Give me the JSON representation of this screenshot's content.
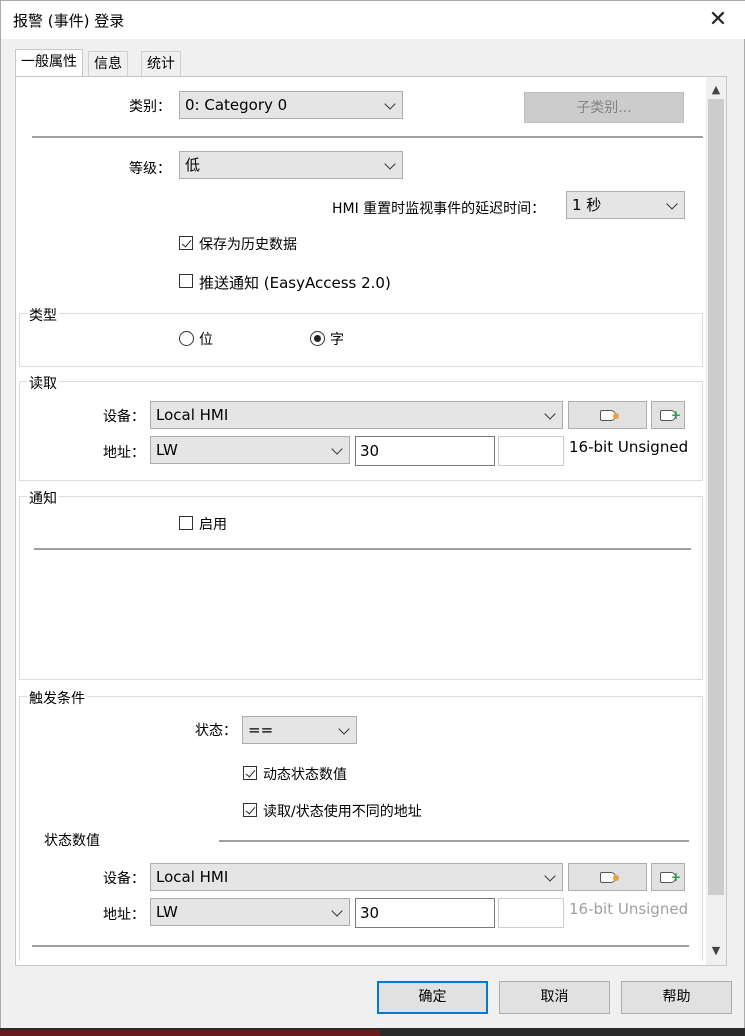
{
  "window": {
    "title": "报警 (事件) 登录",
    "close_glyph": "✕"
  },
  "tabs": [
    {
      "label": "一般属性"
    },
    {
      "label": "信息"
    },
    {
      "label": "统计"
    }
  ],
  "general": {
    "category_label": "类别：",
    "category_value": "0: Category 0",
    "subcategory_button": "子类别...",
    "level_label": "等级：",
    "level_value": "低",
    "delay_label": "HMI 重置时监视事件的延迟时间：",
    "delay_value": "1 秒",
    "save_history_label": "保存为历史数据",
    "save_history_checked": true,
    "push_label": "推送通知 (EasyAccess 2.0)",
    "push_checked": false
  },
  "type_group": {
    "title": "类型",
    "bit_label": "位",
    "word_label": "字",
    "selected": "word"
  },
  "read_group": {
    "title": "读取",
    "device_label": "设备：",
    "device_value": "Local HMI",
    "address_label": "地址：",
    "address_type": "LW",
    "address_value": "30",
    "address_extra": "",
    "data_type": "16-bit Unsigned"
  },
  "notify_group": {
    "title": "通知",
    "enable_label": "启用",
    "enable_checked": false
  },
  "trigger_group": {
    "title": "触发条件",
    "state_label": "状态：",
    "state_value": "==",
    "dynamic_label": "动态状态数值",
    "dynamic_checked": true,
    "diff_addr_label": "读取/状态使用不同的地址",
    "diff_addr_checked": true,
    "state_value_title": "状态数值",
    "device_label": "设备：",
    "device_value": "Local HMI",
    "address_label": "地址：",
    "address_type": "LW",
    "address_value": "30",
    "address_extra": "",
    "data_type": "16-bit Unsigned"
  },
  "footer": {
    "ok": "确定",
    "cancel": "取消",
    "help": "帮助"
  },
  "icons": {
    "tag": "tag-icon",
    "add_tag": "add-tag-icon",
    "scroll_up": "▲",
    "scroll_down": "▼"
  }
}
